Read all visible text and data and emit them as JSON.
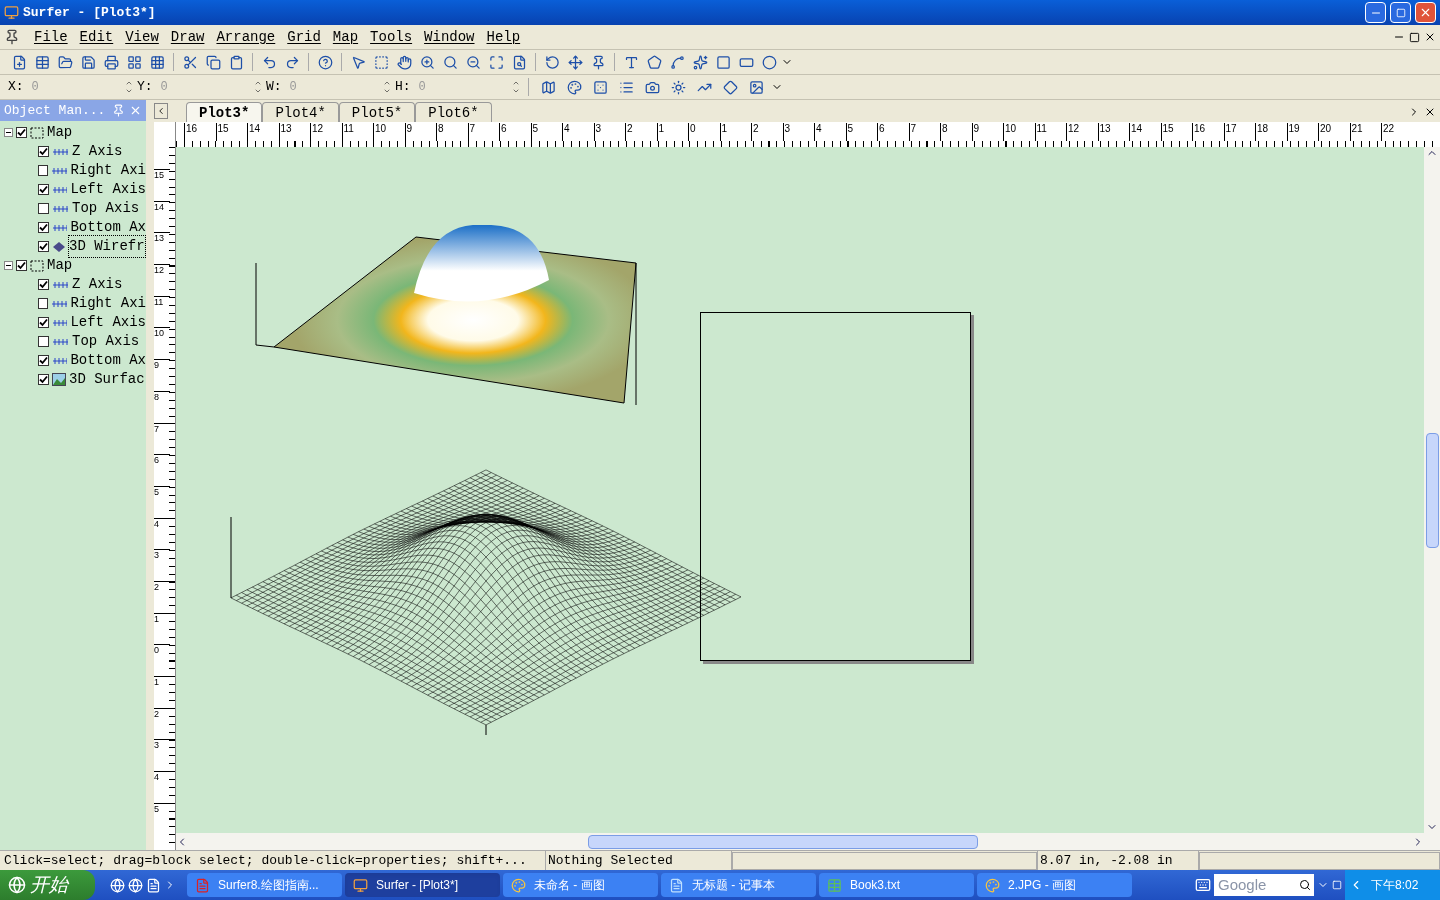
{
  "window": {
    "title": "Surfer - [Plot3*]"
  },
  "menu": [
    "File",
    "Edit",
    "View",
    "Draw",
    "Arrange",
    "Grid",
    "Map",
    "Tools",
    "Window",
    "Help"
  ],
  "coords": [
    {
      "label": "X:",
      "value": "0"
    },
    {
      "label": "Y:",
      "value": "0"
    },
    {
      "label": "W:",
      "value": "0"
    },
    {
      "label": "H:",
      "value": "0"
    }
  ],
  "object_manager": {
    "title": "Object Man...",
    "tree": [
      {
        "label": "Map",
        "kind": "map",
        "checked": true,
        "expanded": true,
        "selected": false,
        "children": [
          {
            "label": "Z Axis",
            "kind": "axis",
            "checked": true,
            "selected": false
          },
          {
            "label": "Right Axi",
            "kind": "axis",
            "checked": false,
            "selected": false
          },
          {
            "label": "Left Axis",
            "kind": "axis",
            "checked": true,
            "selected": false
          },
          {
            "label": "Top Axis",
            "kind": "axis",
            "checked": false,
            "selected": false
          },
          {
            "label": "Bottom Ax",
            "kind": "axis",
            "checked": true,
            "selected": false
          },
          {
            "label": "3D Wirefr",
            "kind": "wireframe",
            "checked": true,
            "selected": true
          }
        ]
      },
      {
        "label": "Map",
        "kind": "map",
        "checked": true,
        "expanded": true,
        "selected": false,
        "children": [
          {
            "label": "Z Axis",
            "kind": "axis",
            "checked": true,
            "selected": false
          },
          {
            "label": "Right Axi",
            "kind": "axis",
            "checked": false,
            "selected": false
          },
          {
            "label": "Left Axis",
            "kind": "axis",
            "checked": true,
            "selected": false
          },
          {
            "label": "Top Axis",
            "kind": "axis",
            "checked": false,
            "selected": false
          },
          {
            "label": "Bottom Ax",
            "kind": "axis",
            "checked": true,
            "selected": false
          },
          {
            "label": "3D Surfac",
            "kind": "surface",
            "checked": true,
            "selected": false
          }
        ]
      }
    ]
  },
  "tabs": [
    {
      "label": "Plot3*",
      "selected": true
    },
    {
      "label": "Plot4*",
      "selected": false
    },
    {
      "label": "Plot5*",
      "selected": false
    },
    {
      "label": "Plot6*",
      "selected": false
    }
  ],
  "ruler_horizontal": [
    "16",
    "15",
    "14",
    "13",
    "12",
    "11",
    "10",
    "9",
    "8",
    "7",
    "6",
    "5",
    "4",
    "3",
    "2",
    "1",
    "0",
    "1",
    "2",
    "3",
    "4",
    "5",
    "6",
    "7",
    "8",
    "9",
    "10",
    "11",
    "12",
    "13",
    "14",
    "15",
    "16",
    "17",
    "18",
    "19",
    "20",
    "21",
    "22"
  ],
  "ruler_vertical": [
    "15",
    "14",
    "13",
    "12",
    "11",
    "10",
    "9",
    "8",
    "7",
    "6",
    "5",
    "4",
    "3",
    "2",
    "1",
    "0",
    "1",
    "2",
    "3",
    "4",
    "5"
  ],
  "status_bar": {
    "hint": "Click=select; drag=block select; double-click=properties; shift+...",
    "selection": "Nothing Selected",
    "position": "8.07 in, -2.08 in"
  },
  "taskbar": {
    "start": "开始",
    "search_placeholder": "Google",
    "clock": "下午8:02",
    "tasks": [
      {
        "label": "Surfer8.绘图指南...",
        "kind": "pdf",
        "active": false
      },
      {
        "label": "Surfer - [Plot3*]",
        "kind": "surfer",
        "active": true
      },
      {
        "label": "未命名 - 画图",
        "kind": "paint",
        "active": false
      },
      {
        "label": "无标题 - 记事本",
        "kind": "notepad",
        "active": false
      },
      {
        "label": "Book3.txt",
        "kind": "excel",
        "active": false
      },
      {
        "label": "2.JPG - 画图",
        "kind": "paint",
        "active": false
      }
    ]
  }
}
